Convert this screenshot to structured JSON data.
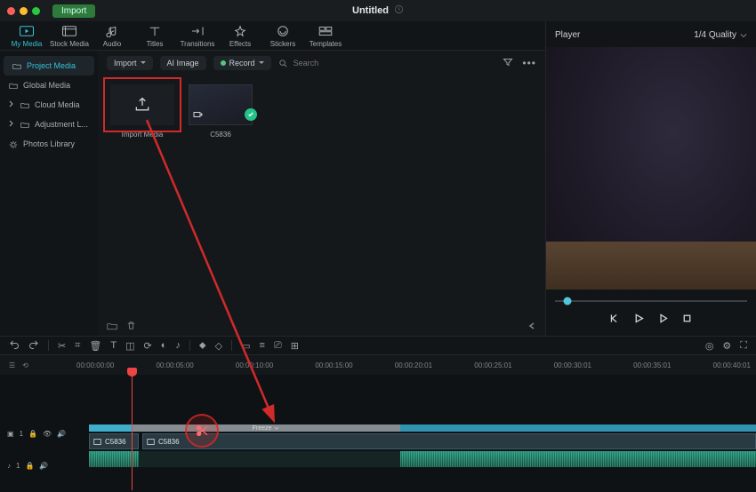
{
  "titlebar": {
    "import_label": "Import",
    "doc_title": "Untitled"
  },
  "section_tabs": [
    {
      "label": "My Media"
    },
    {
      "label": "Stock Media"
    },
    {
      "label": "Audio"
    },
    {
      "label": "Titles"
    },
    {
      "label": "Transitions"
    },
    {
      "label": "Effects"
    },
    {
      "label": "Stickers"
    },
    {
      "label": "Templates"
    }
  ],
  "sidebar": {
    "items": [
      {
        "label": "Project Media"
      },
      {
        "label": "Global Media"
      },
      {
        "label": "Cloud Media"
      },
      {
        "label": "Adjustment L..."
      },
      {
        "label": "Photos Library"
      }
    ]
  },
  "browser_bar": {
    "import_label": "Import",
    "ai_image_label": "AI Image",
    "record_label": "Record",
    "search_placeholder": "Search"
  },
  "tiles": {
    "import_tile_label": "Import Media",
    "clip1_label": "C5836"
  },
  "preview": {
    "player_label": "Player",
    "quality_label": "1/4 Quality"
  },
  "timeline": {
    "ruler": [
      "00:00:00:00",
      "00:00:05:00",
      "00:00:10:00",
      "00:00:15:00",
      "00:00:20:01",
      "00:00:25:01",
      "00:00:30:01",
      "00:00:35:01",
      "00:00:40:01"
    ],
    "track1_label": "1",
    "audio_track_label": "1",
    "freeze_label": "Freeze",
    "clip_name": "C5836"
  }
}
